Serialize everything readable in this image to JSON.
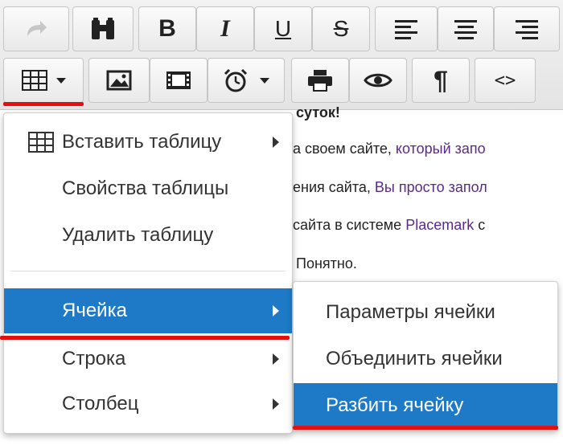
{
  "toolbar": {
    "row1": [
      "redo-icon",
      "find-icon",
      "bold-icon",
      "italic-icon",
      "underline-icon",
      "strikethrough-icon",
      "align-left-icon",
      "align-center-icon",
      "align-right-icon"
    ],
    "row2": [
      "table-icon",
      "image-icon",
      "video-icon",
      "clock-icon",
      "print-icon",
      "preview-icon",
      "pilcrow-icon",
      "code-icon"
    ],
    "bold_glyph": "B",
    "italic_glyph": "I",
    "underline_glyph": "U",
    "strike_glyph": "S",
    "pilcrow_glyph": "¶",
    "code_glyph": "<>"
  },
  "document": {
    "line0": "суток!",
    "line1_a": "а своем сайте, ",
    "line1_link": "который запо",
    "line2_a": "ения сайта, ",
    "line2_link": "Вы просто запол",
    "line3_a": " сайта в системе ",
    "line3_link": "Placemark",
    "line3_b": " с",
    "line4": "Понятно."
  },
  "table_menu": {
    "items": [
      {
        "label": "Вставить таблицу",
        "has_submenu": true
      },
      {
        "label": "Свойства таблицы",
        "has_submenu": false
      },
      {
        "label": "Удалить таблицу",
        "has_submenu": false
      },
      {
        "label": "Ячейка",
        "has_submenu": true,
        "active": true
      },
      {
        "label": "Строка",
        "has_submenu": true
      },
      {
        "label": "Столбец",
        "has_submenu": true
      }
    ]
  },
  "cell_submenu": {
    "items": [
      {
        "label": "Параметры ячейки"
      },
      {
        "label": "Объединить ячейки"
      },
      {
        "label": "Разбить ячейку",
        "active": true
      }
    ]
  },
  "colors": {
    "highlight": "#1e7ac6",
    "red_marker": "#e41010"
  }
}
